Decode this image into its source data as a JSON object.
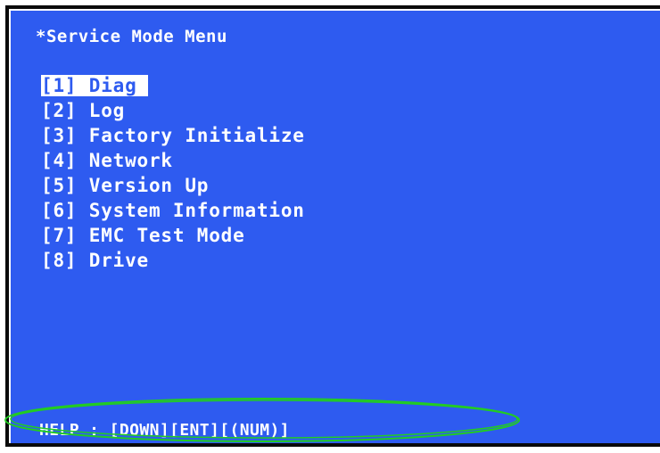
{
  "screen": {
    "title": "*Service Mode Menu",
    "menu": [
      {
        "label": "[1] Diag",
        "selected": true
      },
      {
        "label": "[2] Log",
        "selected": false
      },
      {
        "label": "[3] Factory Initialize",
        "selected": false
      },
      {
        "label": "[4] Network",
        "selected": false
      },
      {
        "label": "[5] Version Up",
        "selected": false
      },
      {
        "label": "[6] System Information",
        "selected": false
      },
      {
        "label": "[7] EMC Test Mode",
        "selected": false
      },
      {
        "label": "[8] Drive",
        "selected": false
      }
    ],
    "help": "HELP : [DOWN][ENT][(NUM)]"
  },
  "colors": {
    "background": "#2e5bf0",
    "text": "#ffffff",
    "highlight_ellipse": "#22cc22"
  }
}
